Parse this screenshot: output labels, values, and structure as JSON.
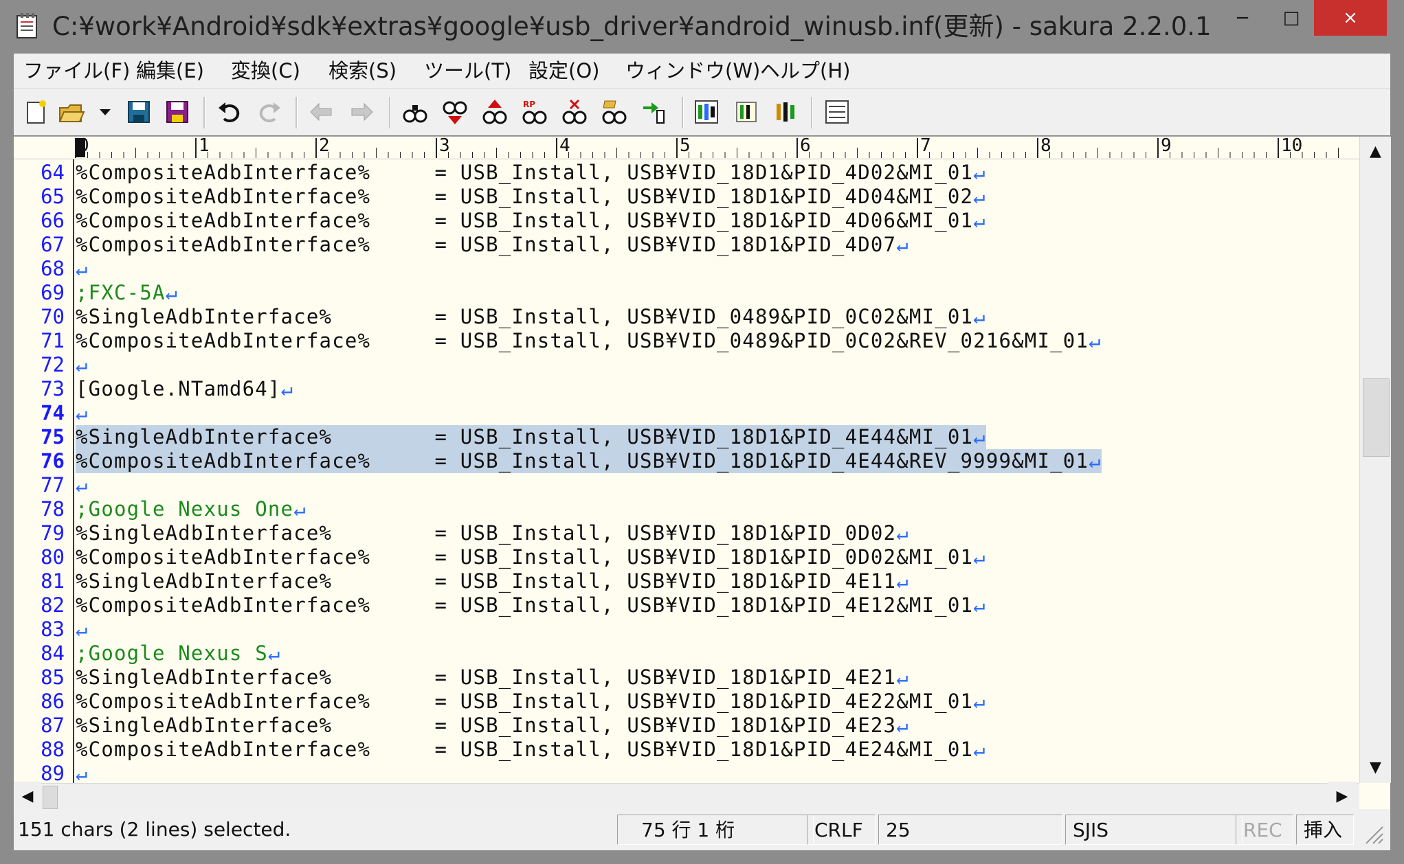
{
  "window": {
    "title": "C:¥work¥Android¥sdk¥extras¥google¥usb_driver¥android_winusb.inf(更新) - sakura 2.2.0.1",
    "minimize": "−",
    "maximize": "□",
    "close": "×"
  },
  "menu": [
    {
      "label": "ファイル(F)"
    },
    {
      "label": "編集(E)"
    },
    {
      "label": "変換(C)"
    },
    {
      "label": "検索(S)"
    },
    {
      "label": "ツール(T)"
    },
    {
      "label": "設定(O)"
    },
    {
      "label": "ウィンドウ(W)"
    },
    {
      "label": "ヘルプ(H)"
    }
  ],
  "toolbar": {
    "icons": [
      "new-file-icon",
      "open-file-icon",
      "open-dropdown-icon",
      "save-icon",
      "save-all-icon",
      "undo-icon",
      "redo-icon",
      "move-back-icon",
      "move-forward-icon",
      "search-icon",
      "search-next-icon",
      "search-prev-icon",
      "replace-icon",
      "clear-search-icon",
      "grep-icon",
      "jump-icon",
      "outline-icon",
      "settings-icon",
      "type-settings-icon",
      "window-list-icon"
    ]
  },
  "ruler": {
    "labels": [
      "0",
      "1",
      "2",
      "3",
      "4",
      "5",
      "6",
      "7",
      "8",
      "9",
      "10"
    ]
  },
  "editor": {
    "lines": [
      {
        "num": "64",
        "text": "%CompositeAdbInterface%     = USB_Install, USB¥VID_18D1&PID_4D02&MI_01",
        "eol": "↵"
      },
      {
        "num": "65",
        "text": "%CompositeAdbInterface%     = USB_Install, USB¥VID_18D1&PID_4D04&MI_02",
        "eol": "↵"
      },
      {
        "num": "66",
        "text": "%CompositeAdbInterface%     = USB_Install, USB¥VID_18D1&PID_4D06&MI_01",
        "eol": "↵"
      },
      {
        "num": "67",
        "text": "%CompositeAdbInterface%     = USB_Install, USB¥VID_18D1&PID_4D07",
        "eol": "↵"
      },
      {
        "num": "68",
        "text": "",
        "eol": "↵"
      },
      {
        "num": "69",
        "text": ";FXC-5A",
        "eol": "↵",
        "comment": true
      },
      {
        "num": "70",
        "text": "%SingleAdbInterface%        = USB_Install, USB¥VID_0489&PID_0C02&MI_01",
        "eol": "↵"
      },
      {
        "num": "71",
        "text": "%CompositeAdbInterface%     = USB_Install, USB¥VID_0489&PID_0C02&REV_0216&MI_01",
        "eol": "↵"
      },
      {
        "num": "72",
        "text": "",
        "eol": "↵"
      },
      {
        "num": "73",
        "text": "[Google.NTamd64]",
        "eol": "↵"
      },
      {
        "num": "74",
        "text": "",
        "eol": "↵",
        "current": true
      },
      {
        "num": "75",
        "text": "%SingleAdbInterface%        = USB_Install, USB¥VID_18D1&PID_4E44&MI_01",
        "eol": "↵",
        "selected": true,
        "current": true
      },
      {
        "num": "76",
        "text": "%CompositeAdbInterface%     = USB_Install, USB¥VID_18D1&PID_4E44&REV_9999&MI_01",
        "eol": "↵",
        "selected": true,
        "current": true
      },
      {
        "num": "77",
        "text": "",
        "eol": "↵"
      },
      {
        "num": "78",
        "text": ";Google Nexus One",
        "eol": "↵",
        "comment": true
      },
      {
        "num": "79",
        "text": "%SingleAdbInterface%        = USB_Install, USB¥VID_18D1&PID_0D02",
        "eol": "↵"
      },
      {
        "num": "80",
        "text": "%CompositeAdbInterface%     = USB_Install, USB¥VID_18D1&PID_0D02&MI_01",
        "eol": "↵"
      },
      {
        "num": "81",
        "text": "%SingleAdbInterface%        = USB_Install, USB¥VID_18D1&PID_4E11",
        "eol": "↵"
      },
      {
        "num": "82",
        "text": "%CompositeAdbInterface%     = USB_Install, USB¥VID_18D1&PID_4E12&MI_01",
        "eol": "↵"
      },
      {
        "num": "83",
        "text": "",
        "eol": "↵"
      },
      {
        "num": "84",
        "text": ";Google Nexus S",
        "eol": "↵",
        "comment": true
      },
      {
        "num": "85",
        "text": "%SingleAdbInterface%        = USB_Install, USB¥VID_18D1&PID_4E21",
        "eol": "↵"
      },
      {
        "num": "86",
        "text": "%CompositeAdbInterface%     = USB_Install, USB¥VID_18D1&PID_4E22&MI_01",
        "eol": "↵"
      },
      {
        "num": "87",
        "text": "%SingleAdbInterface%        = USB_Install, USB¥VID_18D1&PID_4E23",
        "eol": "↵"
      },
      {
        "num": "88",
        "text": "%CompositeAdbInterface%     = USB_Install, USB¥VID_18D1&PID_4E24&MI_01",
        "eol": "↵"
      },
      {
        "num": "89",
        "text": "",
        "eol": "↵"
      }
    ]
  },
  "scroll": {
    "up": "▲",
    "down": "▼",
    "left": "◀",
    "right": "▶"
  },
  "status": {
    "message": "151 chars (2 lines) selected.",
    "position": "75 行    1 桁",
    "eol": "CRLF",
    "char_code": "25",
    "encoding": "SJIS",
    "rec": "REC",
    "mode": "挿入"
  },
  "colors": {
    "linenum": "#1a1aff",
    "comment": "#1b8a1b",
    "selection": "#c3d3e6",
    "background": "#fffdf0",
    "close_button": "#c7302c"
  }
}
